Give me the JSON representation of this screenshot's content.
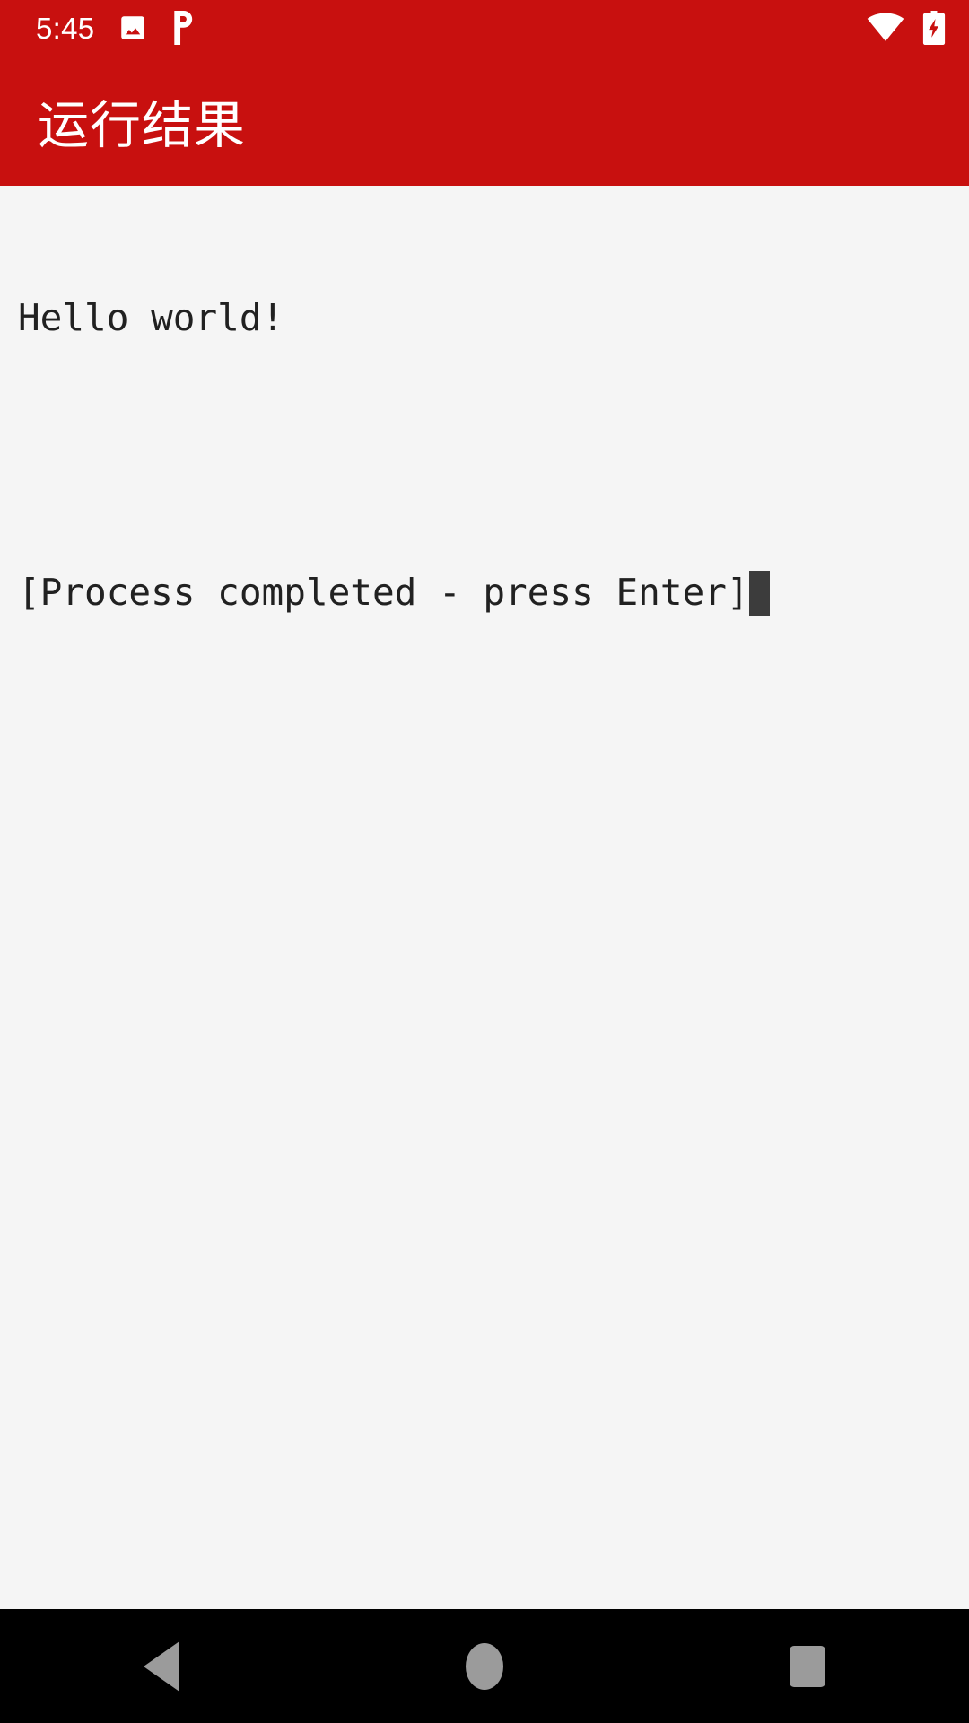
{
  "theme": {
    "appbar_color": "#C8100F",
    "content_bg": "#F5F5F5",
    "navbar_bg": "#000000",
    "text_color": "#212121",
    "cursor_color": "#3C3C3C",
    "nav_icon_color": "#9B9B9B",
    "status_icon_color": "#FFFFFF"
  },
  "status_bar": {
    "clock": "5:45",
    "left_icons": [
      {
        "name": "image-icon",
        "glyph": "photo"
      },
      {
        "name": "p-app-icon",
        "glyph": "P"
      }
    ],
    "right_icons": [
      {
        "name": "wifi-icon",
        "glyph": "wifi-full"
      },
      {
        "name": "battery-charging-icon",
        "glyph": "battery-bolt"
      }
    ]
  },
  "appbar": {
    "title": "运行结果"
  },
  "terminal": {
    "lines": [
      "Hello world!",
      "",
      "[Process completed - press Enter]"
    ],
    "cursor_on_line": 2,
    "cursor_visible": true
  },
  "navbar": {
    "buttons": [
      {
        "name": "nav-back-button",
        "label": "Back"
      },
      {
        "name": "nav-home-button",
        "label": "Home"
      },
      {
        "name": "nav-recents-button",
        "label": "Recents"
      }
    ]
  }
}
